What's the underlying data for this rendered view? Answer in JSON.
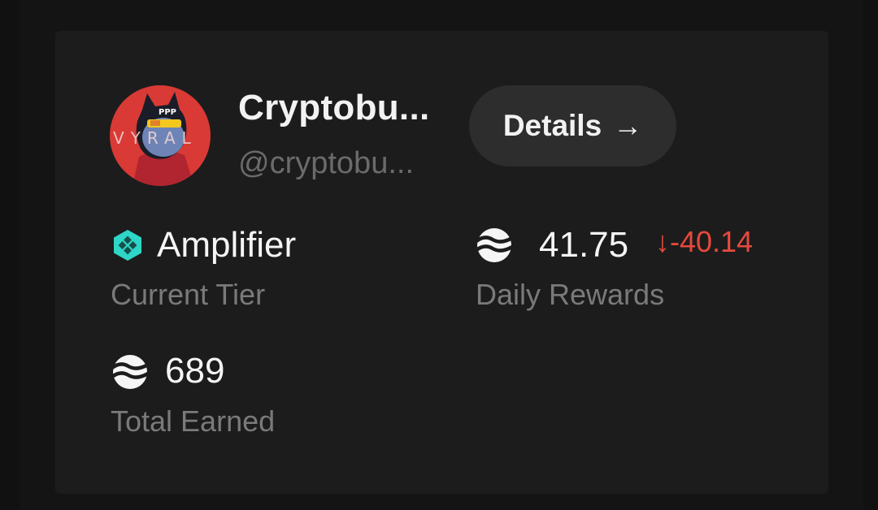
{
  "profile": {
    "display_name": "Cryptobu...",
    "handle": "@cryptobu...",
    "avatar_text": "VYRAL"
  },
  "actions": {
    "details_label": "Details",
    "details_arrow": "→"
  },
  "stats": {
    "tier": {
      "value": "Amplifier",
      "label": "Current Tier",
      "icon": "tier-gem-icon"
    },
    "daily_rewards": {
      "value": "41.75",
      "change": "↓-40.14",
      "label": "Daily Rewards",
      "icon": "token-icon"
    },
    "total_earned": {
      "value": "689",
      "label": "Total Earned",
      "icon": "token-icon"
    }
  },
  "colors": {
    "background": "#111111",
    "card": "#1c1c1c",
    "button": "#2d2d2d",
    "negative": "#e5493d",
    "tier_accent": "#2ed6c8"
  }
}
